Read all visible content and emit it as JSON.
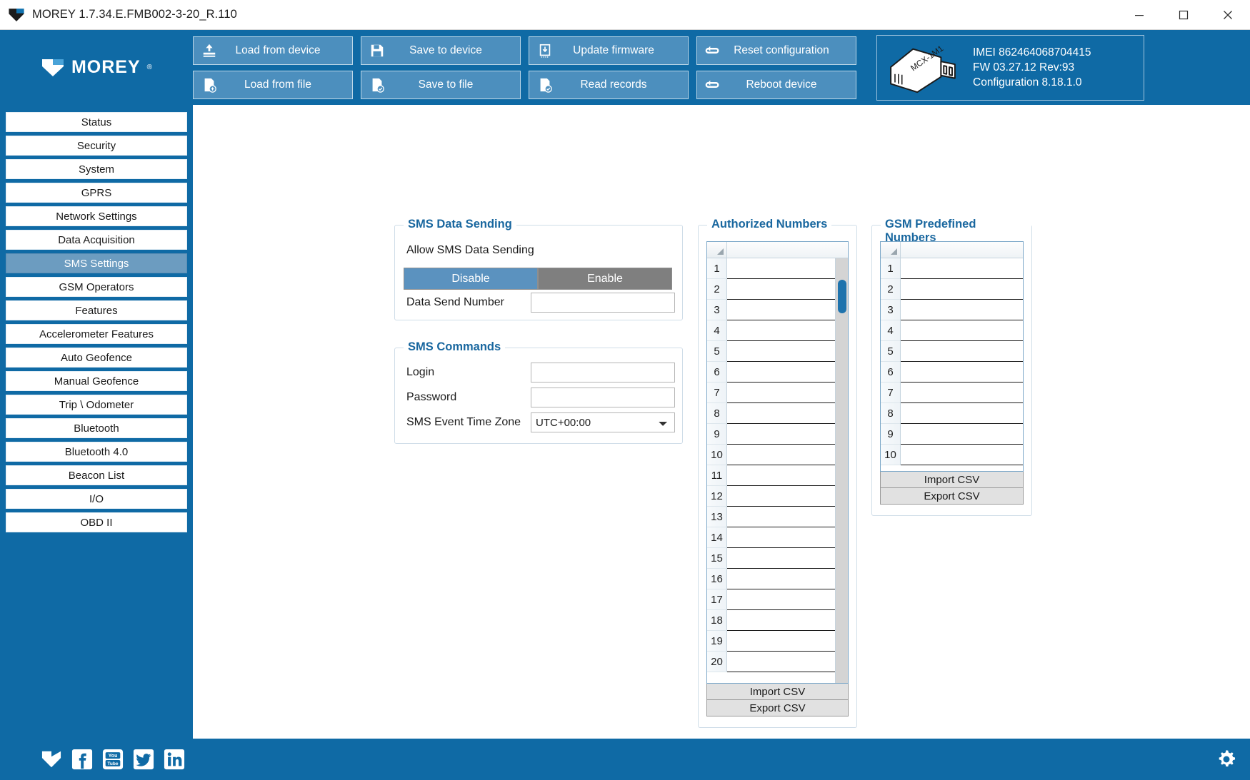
{
  "window": {
    "title": "MOREY 1.7.34.E.FMB002-3-20_R.110",
    "minimize_label": "minimize-icon",
    "maximize_label": "maximize-icon",
    "close_label": "close-icon"
  },
  "brand": {
    "name": "MOREY",
    "tm": "®"
  },
  "toolbar": {
    "buttons": [
      {
        "label": "Load from device",
        "icon": "load-from-device-icon"
      },
      {
        "label": "Save to device",
        "icon": "save-to-device-icon"
      },
      {
        "label": "Update firmware",
        "icon": "update-firmware-icon"
      },
      {
        "label": "Reset configuration",
        "icon": "reset-configuration-icon"
      },
      {
        "label": "Load from file",
        "icon": "load-from-file-icon"
      },
      {
        "label": "Save to file",
        "icon": "save-to-file-icon"
      },
      {
        "label": "Read records",
        "icon": "read-records-icon"
      },
      {
        "label": "Reboot device",
        "icon": "reboot-device-icon"
      }
    ]
  },
  "device": {
    "image_label": "MCX-1M1",
    "imei": "IMEI  862464068704415",
    "firmware": "FW  03.27.12 Rev:93",
    "configuration": "Configuration  8.18.1.0"
  },
  "sidebar": {
    "active": "SMS Settings",
    "items": [
      {
        "label": "Status"
      },
      {
        "label": "Security"
      },
      {
        "label": "System"
      },
      {
        "label": "GPRS"
      },
      {
        "label": "Network Settings"
      },
      {
        "label": "Data Acquisition"
      },
      {
        "label": "SMS Settings"
      },
      {
        "label": "GSM Operators"
      },
      {
        "label": "Features"
      },
      {
        "label": "Accelerometer Features"
      },
      {
        "label": "Auto Geofence"
      },
      {
        "label": "Manual Geofence"
      },
      {
        "label": "Trip \\ Odometer"
      },
      {
        "label": "Bluetooth"
      },
      {
        "label": "Bluetooth 4.0"
      },
      {
        "label": "Beacon List"
      },
      {
        "label": "I/O"
      },
      {
        "label": "OBD II"
      }
    ]
  },
  "sms_data_sending": {
    "title": "SMS Data Sending",
    "allow_label": "Allow SMS Data Sending",
    "disable_label": "Disable",
    "enable_label": "Enable",
    "selected": "Disable",
    "data_send_number_label": "Data Send Number",
    "data_send_number_value": "",
    "data_send_number_placeholder": ""
  },
  "sms_commands": {
    "title": "SMS Commands",
    "login_label": "Login",
    "login_value": "",
    "password_label": "Password",
    "password_value": "",
    "timezone_label": "SMS Event Time Zone",
    "timezone_value": "UTC+00:00"
  },
  "authorized_numbers": {
    "title": "Authorized Numbers",
    "rows": [
      {
        "num": "1",
        "value": ""
      },
      {
        "num": "2",
        "value": ""
      },
      {
        "num": "3",
        "value": ""
      },
      {
        "num": "4",
        "value": ""
      },
      {
        "num": "5",
        "value": ""
      },
      {
        "num": "6",
        "value": ""
      },
      {
        "num": "7",
        "value": ""
      },
      {
        "num": "8",
        "value": ""
      },
      {
        "num": "9",
        "value": ""
      },
      {
        "num": "10",
        "value": ""
      },
      {
        "num": "11",
        "value": ""
      },
      {
        "num": "12",
        "value": ""
      },
      {
        "num": "13",
        "value": ""
      },
      {
        "num": "14",
        "value": ""
      },
      {
        "num": "15",
        "value": ""
      },
      {
        "num": "16",
        "value": ""
      },
      {
        "num": "17",
        "value": ""
      },
      {
        "num": "18",
        "value": ""
      },
      {
        "num": "19",
        "value": ""
      },
      {
        "num": "20",
        "value": ""
      }
    ],
    "import_label": "Import CSV",
    "export_label": "Export CSV",
    "scroll_thumb_top_pct": 5,
    "scroll_thumb_height_pct": 8
  },
  "gsm_predefined_numbers": {
    "title": "GSM Predefined Numbers",
    "rows": [
      {
        "num": "1",
        "value": ""
      },
      {
        "num": "2",
        "value": ""
      },
      {
        "num": "3",
        "value": ""
      },
      {
        "num": "4",
        "value": ""
      },
      {
        "num": "5",
        "value": ""
      },
      {
        "num": "6",
        "value": ""
      },
      {
        "num": "7",
        "value": ""
      },
      {
        "num": "8",
        "value": ""
      },
      {
        "num": "9",
        "value": ""
      },
      {
        "num": "10",
        "value": ""
      }
    ],
    "import_label": "Import CSV",
    "export_label": "Export CSV"
  },
  "footer": {
    "social": [
      {
        "name": "morey-logo-icon"
      },
      {
        "name": "facebook-icon"
      },
      {
        "name": "youtube-icon"
      },
      {
        "name": "twitter-icon"
      },
      {
        "name": "linkedin-icon"
      }
    ],
    "settings_icon": "gear-icon"
  },
  "colors": {
    "brand_blue": "#0f6aa5",
    "toolbar_button": "#4c8fbe",
    "active_item": "#6c9cc0",
    "legend_blue": "#19679f",
    "toggle_off": "#7f7f7f",
    "toggle_on": "#5b92bf",
    "scroll_thumb": "#1e73ad"
  }
}
